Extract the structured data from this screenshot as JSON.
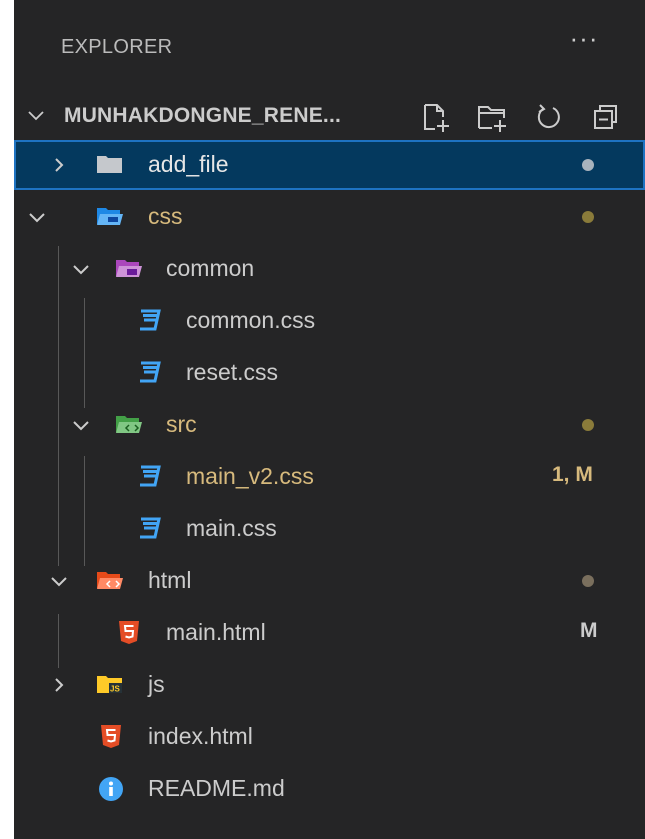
{
  "panel": {
    "title": "EXPLORER",
    "more_label": "···"
  },
  "section": {
    "title": "MUNHAKDONGNE_RENE...",
    "actions": [
      "new-file-icon",
      "new-folder-icon",
      "refresh-icon",
      "collapse-all-icon"
    ]
  },
  "tree": [
    {
      "label": "add_file",
      "kind": "folder",
      "expanded": false,
      "selected": true,
      "decoration": "dot",
      "dot_color": "#a8b3bd"
    },
    {
      "label": "css",
      "kind": "folder",
      "expanded": true,
      "label_color": "#d7ba7d",
      "decoration": "dot",
      "dot_color": "#8a7b3a"
    },
    {
      "label": "common",
      "kind": "folder",
      "expanded": true
    },
    {
      "label": "common.css",
      "kind": "css-file"
    },
    {
      "label": "reset.css",
      "kind": "css-file"
    },
    {
      "label": "src",
      "kind": "folder",
      "expanded": true,
      "label_color": "#d7ba7d",
      "decoration": "dot",
      "dot_color": "#8a7b3a"
    },
    {
      "label": "main_v2.css",
      "kind": "css-file",
      "label_color": "#d7ba7d",
      "decoration": "status",
      "status": "1, M",
      "status_color": "#d7ba7d"
    },
    {
      "label": "main.css",
      "kind": "css-file"
    },
    {
      "label": "html",
      "kind": "folder",
      "expanded": true,
      "decoration": "dot",
      "dot_color": "#7a6f5d"
    },
    {
      "label": "main.html",
      "kind": "html-file",
      "decoration": "status",
      "status": "M",
      "status_color": "#cccccc"
    },
    {
      "label": "js",
      "kind": "folder",
      "expanded": false
    },
    {
      "label": "index.html",
      "kind": "html-file"
    },
    {
      "label": "README.md",
      "kind": "info-file"
    }
  ],
  "colors": {
    "background": "#252526",
    "selection": "#04395e",
    "selection_border": "#1e73c2",
    "modified": "#d7ba7d",
    "css_icon": "#42a5f5",
    "html_icon": "#e44d26"
  }
}
